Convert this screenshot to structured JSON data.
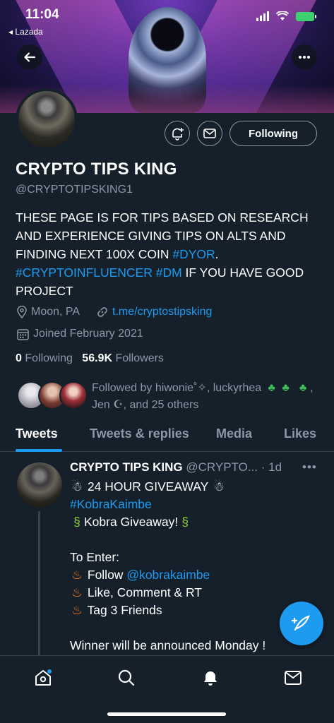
{
  "status_bar": {
    "time": "11:04",
    "back_app": "◂ Lazada"
  },
  "profile": {
    "display_name": "CRYPTO TIPS KING",
    "handle": "@CRYPTOTIPSKING1",
    "follow_button": "Following",
    "bio": {
      "text_1": "THESE PAGE IS FOR TIPS BASED ON RESEARCH AND EXPERIENCE GIVING TIPS ON ALTS AND FINDING NEXT 100X COIN ",
      "tag_dyor": "#DYOR",
      "period": ".",
      "tag_influencer": "#CRYPTOINFLUENCER",
      "tag_dm": "#DM",
      "text_2": " IF YOU HAVE GOOD PROJECT"
    },
    "location": "Moon, PA",
    "website": "t.me/cryptostipsking",
    "joined": "Joined February 2021",
    "following_count": "0",
    "following_label": "Following",
    "followers_count": "56.9K",
    "followers_label": "Followers",
    "followed_by_1": "Followed by hiwonie˚✧, luckyrhea",
    "followed_by_2": ", Jen ☪, and 25 others"
  },
  "tabs": [
    "Tweets",
    "Tweets & replies",
    "Media",
    "Likes"
  ],
  "tweet": {
    "author": "CRYPTO TIPS KING",
    "handle": "@CRYPTO...",
    "time": "· 1d",
    "more": "•••",
    "line1": "24 HOUR GIVEAWAY",
    "line2": "#KobraKaimbe",
    "line3": "Kobra Giveaway!",
    "line4": "To Enter:",
    "line5_text": "Follow ",
    "line5_link": "@kobrakaimbe",
    "line6": "Like, Comment & RT",
    "line7": "Tag 3 Friends",
    "line8": "Winner will be announced Monday !"
  },
  "colors": {
    "background": "#15202b",
    "accent": "#1d9bf0",
    "secondary_text": "#8b98a5",
    "border": "#38444d"
  },
  "icons": [
    "back-arrow-icon",
    "more-icon",
    "bell-plus-icon",
    "mail-icon",
    "location-icon",
    "link-icon",
    "calendar-icon",
    "compose-icon",
    "home-icon",
    "search-icon",
    "notifications-icon",
    "messages-icon"
  ]
}
